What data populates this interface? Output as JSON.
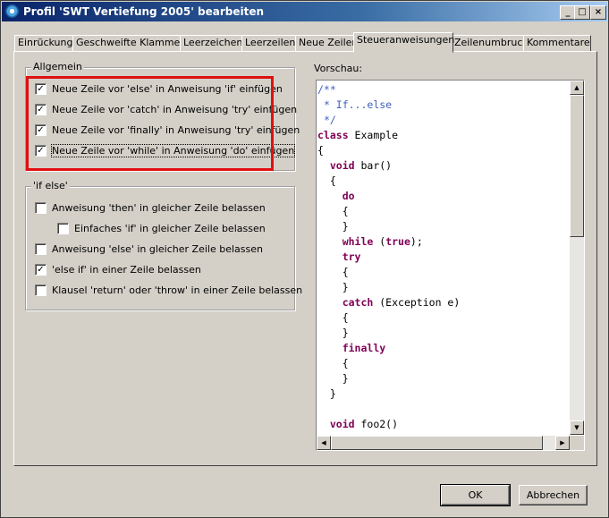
{
  "window": {
    "title": "Profil 'SWT Vertiefung 2005' bearbeiten",
    "minimize_glyph": "_",
    "maximize_glyph": "□",
    "close_glyph": "×"
  },
  "tabs": [
    {
      "label": "Einrückung"
    },
    {
      "label": "Geschweifte Klammern"
    },
    {
      "label": "Leerzeichen"
    },
    {
      "label": "Leerzeilen"
    },
    {
      "label": "Neue Zeilen"
    },
    {
      "label": "Steueranweisungen"
    },
    {
      "label": "Zeilenumbruch"
    },
    {
      "label": "Kommentare"
    }
  ],
  "active_tab": "Steueranweisungen",
  "general": {
    "label": "Allgemein",
    "options": [
      {
        "label": "Neue Zeile vor 'else' in Anweisung 'if' einfügen",
        "checked": true
      },
      {
        "label": "Neue Zeile vor 'catch' in Anweisung 'try' einfügen",
        "checked": true
      },
      {
        "label": "Neue Zeile vor 'finally' in Anweisung 'try' einfügen",
        "checked": true
      },
      {
        "label": "Neue Zeile vor 'while' in Anweisung 'do' einfügen",
        "checked": true
      }
    ]
  },
  "ifelse": {
    "label": "'if else'",
    "options": [
      {
        "label": "Anweisung 'then' in gleicher Zeile belassen",
        "checked": false
      },
      {
        "label": "Einfaches 'if' in gleicher Zeile belassen",
        "checked": false
      },
      {
        "label": "Anweisung 'else' in gleicher Zeile belassen",
        "checked": false
      },
      {
        "label": "'else if' in einer Zeile belassen",
        "checked": true
      },
      {
        "label": "Klausel 'return' oder 'throw' in einer Zeile belassen",
        "checked": false
      }
    ]
  },
  "preview": {
    "label": "Vorschau:",
    "lines": [
      {
        "indent": "",
        "parts": [
          {
            "t": "/**",
            "c": "cm"
          }
        ]
      },
      {
        "indent": " ",
        "parts": [
          {
            "t": "* If...else",
            "c": "cm"
          }
        ]
      },
      {
        "indent": " ",
        "parts": [
          {
            "t": "*/",
            "c": "cm"
          }
        ]
      },
      {
        "indent": "",
        "parts": [
          {
            "t": "class",
            "c": "kw"
          },
          {
            "t": " Example",
            "c": ""
          }
        ]
      },
      {
        "indent": "",
        "parts": [
          {
            "t": "{",
            "c": ""
          }
        ]
      },
      {
        "indent": "  ",
        "parts": [
          {
            "t": "void",
            "c": "kw"
          },
          {
            "t": " bar()",
            "c": ""
          }
        ]
      },
      {
        "indent": "  ",
        "parts": [
          {
            "t": "{",
            "c": ""
          }
        ]
      },
      {
        "indent": "    ",
        "parts": [
          {
            "t": "do",
            "c": "kw"
          }
        ]
      },
      {
        "indent": "    ",
        "parts": [
          {
            "t": "{",
            "c": ""
          }
        ]
      },
      {
        "indent": "    ",
        "parts": [
          {
            "t": "}",
            "c": ""
          }
        ]
      },
      {
        "indent": "    ",
        "parts": [
          {
            "t": "while",
            "c": "kw"
          },
          {
            "t": " (",
            "c": ""
          },
          {
            "t": "true",
            "c": "kw"
          },
          {
            "t": ");",
            "c": ""
          }
        ]
      },
      {
        "indent": "    ",
        "parts": [
          {
            "t": "try",
            "c": "kw"
          }
        ]
      },
      {
        "indent": "    ",
        "parts": [
          {
            "t": "{",
            "c": ""
          }
        ]
      },
      {
        "indent": "    ",
        "parts": [
          {
            "t": "}",
            "c": ""
          }
        ]
      },
      {
        "indent": "    ",
        "parts": [
          {
            "t": "catch",
            "c": "kw"
          },
          {
            "t": " (Exception e)",
            "c": ""
          }
        ]
      },
      {
        "indent": "    ",
        "parts": [
          {
            "t": "{",
            "c": ""
          }
        ]
      },
      {
        "indent": "    ",
        "parts": [
          {
            "t": "}",
            "c": ""
          }
        ]
      },
      {
        "indent": "    ",
        "parts": [
          {
            "t": "finally",
            "c": "kw"
          }
        ]
      },
      {
        "indent": "    ",
        "parts": [
          {
            "t": "{",
            "c": ""
          }
        ]
      },
      {
        "indent": "    ",
        "parts": [
          {
            "t": "}",
            "c": ""
          }
        ]
      },
      {
        "indent": "  ",
        "parts": [
          {
            "t": "}",
            "c": ""
          }
        ]
      },
      {
        "indent": "",
        "parts": [
          {
            "t": "",
            "c": ""
          }
        ]
      },
      {
        "indent": "  ",
        "parts": [
          {
            "t": "void",
            "c": "kw"
          },
          {
            "t": " foo2()",
            "c": ""
          }
        ]
      }
    ]
  },
  "buttons": {
    "ok": "OK",
    "cancel": "Abbrechen"
  },
  "colors": {
    "highlight": "#e01010",
    "comment": "#3f5fbf",
    "keyword": "#7f0055"
  }
}
